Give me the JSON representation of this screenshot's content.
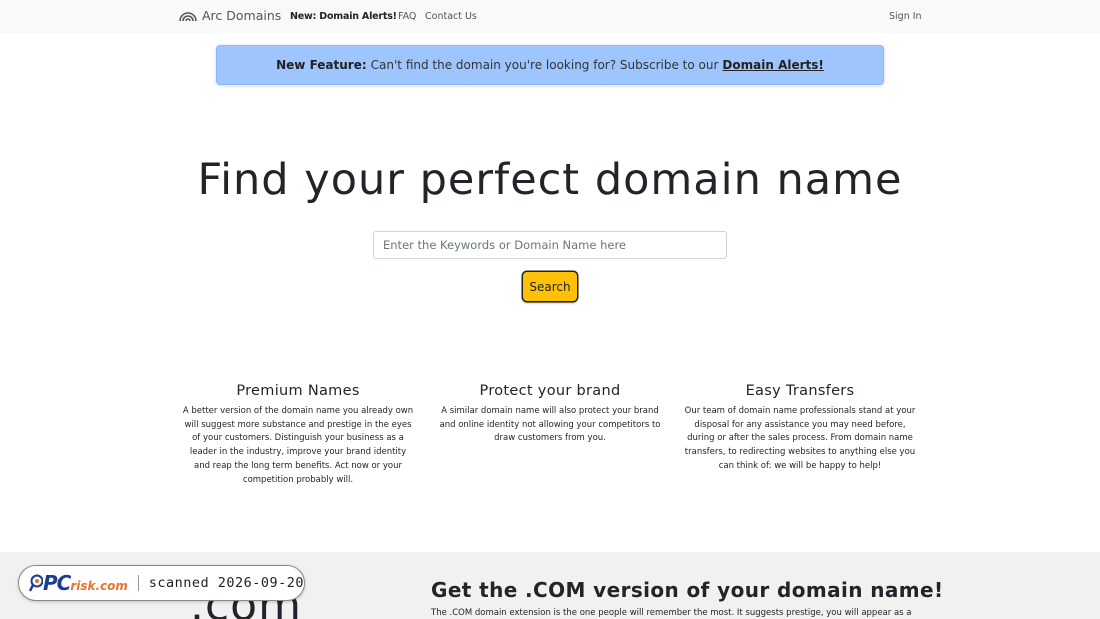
{
  "nav": {
    "brand": "Arc Domains",
    "new_link": "New: Domain Alerts!",
    "faq": "FAQ",
    "contact": "Contact Us",
    "sign_in": "Sign In",
    "brand_icon": "signal-arc-icon"
  },
  "alert": {
    "lead": "New Feature:",
    "text": "Can't find the domain you're looking for? Subscribe to our",
    "link": "Domain Alerts!",
    "background": "#9ec5fe"
  },
  "hero": {
    "title": "Find your perfect domain name",
    "search_placeholder": "Enter the Keywords or Domain Name here",
    "search_value": "",
    "search_button": "Search",
    "button_color": "#ffc107"
  },
  "features": [
    {
      "title": "Premium Names",
      "text": "A better version of the domain name you already own will suggest more substance and prestige in the eyes of your customers. Distinguish your business as a leader in the industry, improve your brand identity and reap the long term benefits. Act now or your competition probably will."
    },
    {
      "title": "Protect your brand",
      "text": "A similar domain name will also protect your brand and online identity not allowing your competitors to draw customers from you."
    },
    {
      "title": "Easy Transfers",
      "text": "Our team of domain name professionals stand at your disposal for any assistance you may need before, during or after the sales process. From domain name transfers, to redirecting websites to anything else you can think of: we will be happy to help!"
    }
  ],
  "bottom": {
    "big_text": ".com",
    "title": "Get the .COM version of your domain name!",
    "text": "The .COM domain extension is the one people will remember the most. It suggests prestige, you will appear as a"
  },
  "watermark": {
    "logo_pc": "PC",
    "logo_risk": "risk.com",
    "scanned": "scanned 2026-09-20"
  }
}
